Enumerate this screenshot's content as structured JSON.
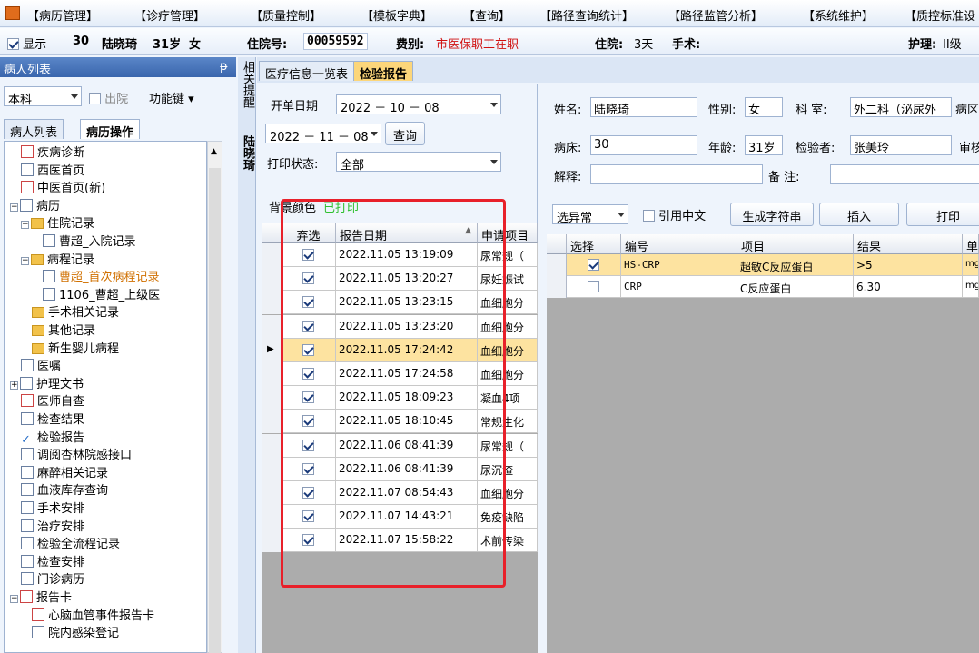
{
  "menu": {
    "items": [
      "【病历管理】",
      "【诊疗管理】",
      "【质量控制】",
      "【模板字典】",
      "【查询】",
      "【路径查询统计】",
      "【路径监管分析】",
      "【系统维护】",
      "【质控标准设"
    ]
  },
  "patient_bar": {
    "show_label": "显示",
    "bed": "30",
    "name": "陆晓琦",
    "age": "31岁",
    "sex": "女",
    "admission_label": "住院号:",
    "admission_no": "00059592",
    "fee_label": "费别:",
    "fee_value": "市医保职工在职",
    "stay_label": "住院:",
    "stay_value": "3天",
    "surgery_label": "手术:",
    "nursing_label": "护理:",
    "nursing_value": "II级"
  },
  "left": {
    "header": "病人列表",
    "pin": "ᵽ",
    "dept_select": "本科",
    "discharge_label": "出院",
    "func_key": "功能键",
    "tabs": [
      "病人列表",
      "病历操作"
    ],
    "tree": [
      {
        "label": "疾病诊断",
        "level": 1,
        "icon": "red"
      },
      {
        "label": "西医首页",
        "level": 1,
        "icon": "doc"
      },
      {
        "label": "中医首页(新)",
        "level": 1,
        "icon": "red"
      },
      {
        "label": "病历",
        "level": 0,
        "icon": "doc",
        "exp": "−"
      },
      {
        "label": "住院记录",
        "level": 1,
        "icon": "folder",
        "exp": "−"
      },
      {
        "label": "曹超_入院记录",
        "level": 3,
        "icon": "doc"
      },
      {
        "label": "病程记录",
        "level": 1,
        "icon": "folder",
        "exp": "−"
      },
      {
        "label": "曹超_首次病程记录",
        "level": 3,
        "icon": "doc",
        "color": "#d07000"
      },
      {
        "label": "1106_曹超_上级医",
        "level": 3,
        "icon": "doc"
      },
      {
        "label": "手术相关记录",
        "level": 2,
        "icon": "folder"
      },
      {
        "label": "其他记录",
        "level": 2,
        "icon": "folder"
      },
      {
        "label": "新生婴儿病程",
        "level": 2,
        "icon": "folder"
      },
      {
        "label": "医嘱",
        "level": 1,
        "icon": "doc"
      },
      {
        "label": "护理文书",
        "level": 0,
        "icon": "doc",
        "exp": "+"
      },
      {
        "label": "医师自查",
        "level": 1,
        "icon": "red"
      },
      {
        "label": "检查结果",
        "level": 1,
        "icon": "doc"
      },
      {
        "label": "检验报告",
        "level": 1,
        "icon": "check"
      },
      {
        "label": "调阅杏林院感接口",
        "level": 1,
        "icon": "doc"
      },
      {
        "label": "麻醉相关记录",
        "level": 1,
        "icon": "doc"
      },
      {
        "label": "血液库存查询",
        "level": 1,
        "icon": "doc"
      },
      {
        "label": "手术安排",
        "level": 1,
        "icon": "doc"
      },
      {
        "label": "治疗安排",
        "level": 1,
        "icon": "doc"
      },
      {
        "label": "检验全流程记录",
        "level": 1,
        "icon": "doc"
      },
      {
        "label": "检查安排",
        "level": 1,
        "icon": "doc"
      },
      {
        "label": "门诊病历",
        "level": 1,
        "icon": "doc"
      },
      {
        "label": "报告卡",
        "level": 0,
        "icon": "red",
        "exp": "−"
      },
      {
        "label": "心脑血管事件报告卡",
        "level": 2,
        "icon": "red"
      },
      {
        "label": "院内感染登记",
        "level": 2,
        "icon": "doc"
      }
    ]
  },
  "side_strip": {
    "text1": "相关提醒",
    "text2": "陆晓琦"
  },
  "main_tabs": [
    "医疗信息一览表",
    "检验报告"
  ],
  "mid": {
    "start_label": "开单日期",
    "start_date": "2022 － 10 － 08",
    "end_date": "2022 － 11 － 08",
    "query_btn": "查询",
    "print_label": "打印状态:",
    "print_value": "全部",
    "bg_label": "背景颜色",
    "printed_label": "已打印",
    "cols": [
      "弃选",
      "报告日期",
      "申请项目"
    ],
    "rows": [
      {
        "date": "2022.11.05 13:19:09",
        "item": "尿常规（"
      },
      {
        "date": "2022.11.05 13:20:27",
        "item": "尿妊娠试"
      },
      {
        "date": "2022.11.05 13:23:15",
        "item": "血细胞分"
      },
      {
        "date": "2022.11.05 13:23:20",
        "item": "血细胞分"
      },
      {
        "date": "2022.11.05 17:24:42",
        "item": "血细胞分"
      },
      {
        "date": "2022.11.05 17:24:58",
        "item": "血细胞分"
      },
      {
        "date": "2022.11.05 18:09:23",
        "item": "凝血4项"
      },
      {
        "date": "2022.11.05 18:10:45",
        "item": "常规生化"
      },
      {
        "date": "2022.11.06 08:41:39",
        "item": "尿常规（"
      },
      {
        "date": "2022.11.06 08:41:39",
        "item": "尿沉渣"
      },
      {
        "date": "2022.11.07 08:54:43",
        "item": "血细胞分"
      },
      {
        "date": "2022.11.07 14:43:21",
        "item": "免疫缺陷"
      },
      {
        "date": "2022.11.07 15:58:22",
        "item": "术前传染"
      }
    ]
  },
  "right": {
    "name_label": "姓名:",
    "name_value": "陆晓琦",
    "sex_label": "性别:",
    "sex_value": "女",
    "dept_label": "科  室:",
    "dept_value": "外二科（泌尿外",
    "ward_label": "病区",
    "bed_label": "病床:",
    "bed_value": "30",
    "age_label": "年龄:",
    "age_value": "31岁",
    "tester_label": "检验者:",
    "tester_value": "张美玲",
    "reviewer_label": "审核",
    "explain_label": "解释:",
    "remark_label": "备  注:",
    "abn_select": "选异常",
    "cite_label": "引用中文",
    "gen_btn": "生成字符串",
    "insert_btn": "插入",
    "print_btn": "打印",
    "cols": [
      "选择",
      "编号",
      "项目",
      "结果",
      "单"
    ],
    "rows": [
      {
        "checked": true,
        "code": "HS-CRP",
        "item": "超敏C反应蛋白",
        "result": ">5",
        "unit": "mg"
      },
      {
        "checked": false,
        "code": "CRP",
        "item": "C反应蛋白",
        "result": "6.30",
        "unit": "mg"
      }
    ]
  }
}
